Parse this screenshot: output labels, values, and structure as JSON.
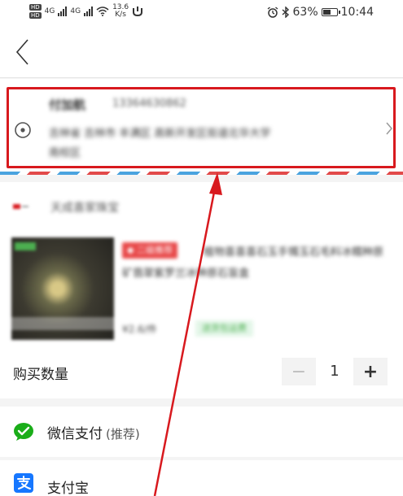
{
  "status_bar": {
    "hd_badge": "HD",
    "network_label": "4G",
    "speed_value": "13.6",
    "speed_unit": "K/s",
    "battery_percent": "63%",
    "battery_level": 0.63,
    "time": "10:44"
  },
  "header": {
    "back_icon": "chevron-left-icon"
  },
  "address": {
    "name": "付加航",
    "phone": "13364630862",
    "line1": "吉林省 吉林市 丰满区 高新开发区街道北华大学",
    "line2": "南校区",
    "location_icon": "location-pin-icon",
    "chevron_icon": "chevron-right-icon",
    "highlight_color": "#d8191e"
  },
  "shop": {
    "name": "天成喜家珠宝"
  },
  "product": {
    "promo_badge": "◆ 二级推荐",
    "title": "植物喜喜喜石玉手镯玉石毛料冰糯种原矿翡翠紫罗兰冰种原石盲盒",
    "price": "¥2.6/件",
    "tag": "送货包运费"
  },
  "quantity": {
    "label": "购买数量",
    "minus": "−",
    "value": "1",
    "plus": "+"
  },
  "payment": {
    "wechat_label": "微信支付",
    "wechat_note": "(推荐)",
    "wechat_color": "#1aad19",
    "alipay_label": "支付宝",
    "alipay_color": "#1677ff"
  },
  "annotation": {
    "arrow_color": "#d8191e"
  }
}
